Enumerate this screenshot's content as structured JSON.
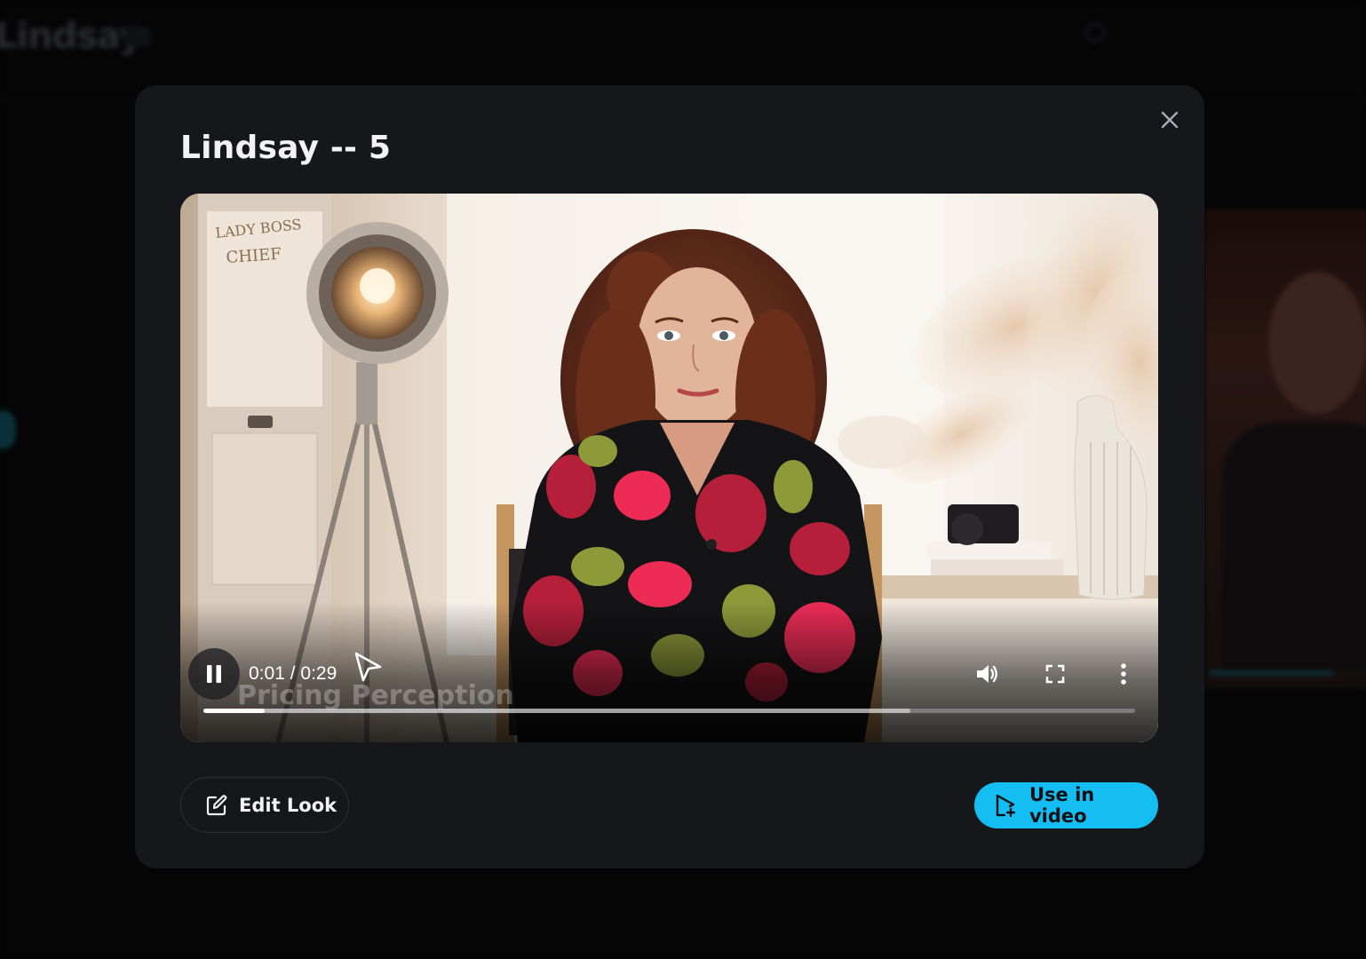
{
  "background_app": {
    "logo_text": "Lindsay",
    "colors": {
      "page_bg": "#050506",
      "accent": "#14bdf2"
    }
  },
  "modal": {
    "title": "Lindsay -- 5",
    "close_icon": "close-icon",
    "background": "#16171b"
  },
  "player": {
    "state": "playing",
    "current_time": "0:01",
    "duration": "0:29",
    "time_separator": " / ",
    "caption_overlay": "Pricing Perception",
    "played_fraction": 0.066,
    "buffered_fraction": 0.759,
    "icons": {
      "pause": "pause-icon",
      "volume": "volume-icon",
      "fullscreen": "fullscreen-icon",
      "more": "more-vertical-icon"
    }
  },
  "actions": {
    "edit_look_label": "Edit Look",
    "edit_look_icon": "edit-icon",
    "use_in_video_label": "Use in video",
    "use_in_video_icon": "add-to-video-icon",
    "primary_color": "#14bdf2"
  }
}
